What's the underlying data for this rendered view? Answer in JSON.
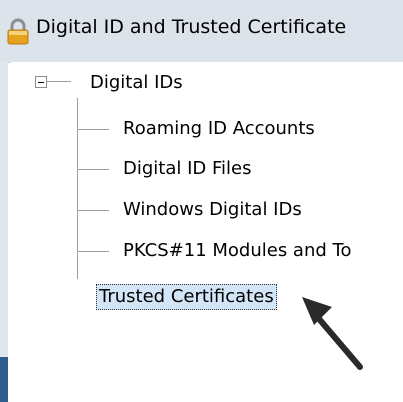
{
  "window": {
    "title": "Digital ID and Trusted Certificate"
  },
  "tree": {
    "root": {
      "label": "Digital IDs",
      "expanded": true
    },
    "children": [
      {
        "label": "Roaming ID Accounts"
      },
      {
        "label": "Digital ID Files"
      },
      {
        "label": "Windows Digital IDs"
      },
      {
        "label": "PKCS#11 Modules and To"
      }
    ],
    "sibling": {
      "label": "Trusted Certificates",
      "selected": true
    }
  },
  "icons": {
    "title": "lock-icon",
    "expander": "collapse-icon",
    "pointer": "arrow-pointer-icon"
  },
  "colors": {
    "selection": "#d3e6f8",
    "titlebar": "#dde3ea"
  }
}
